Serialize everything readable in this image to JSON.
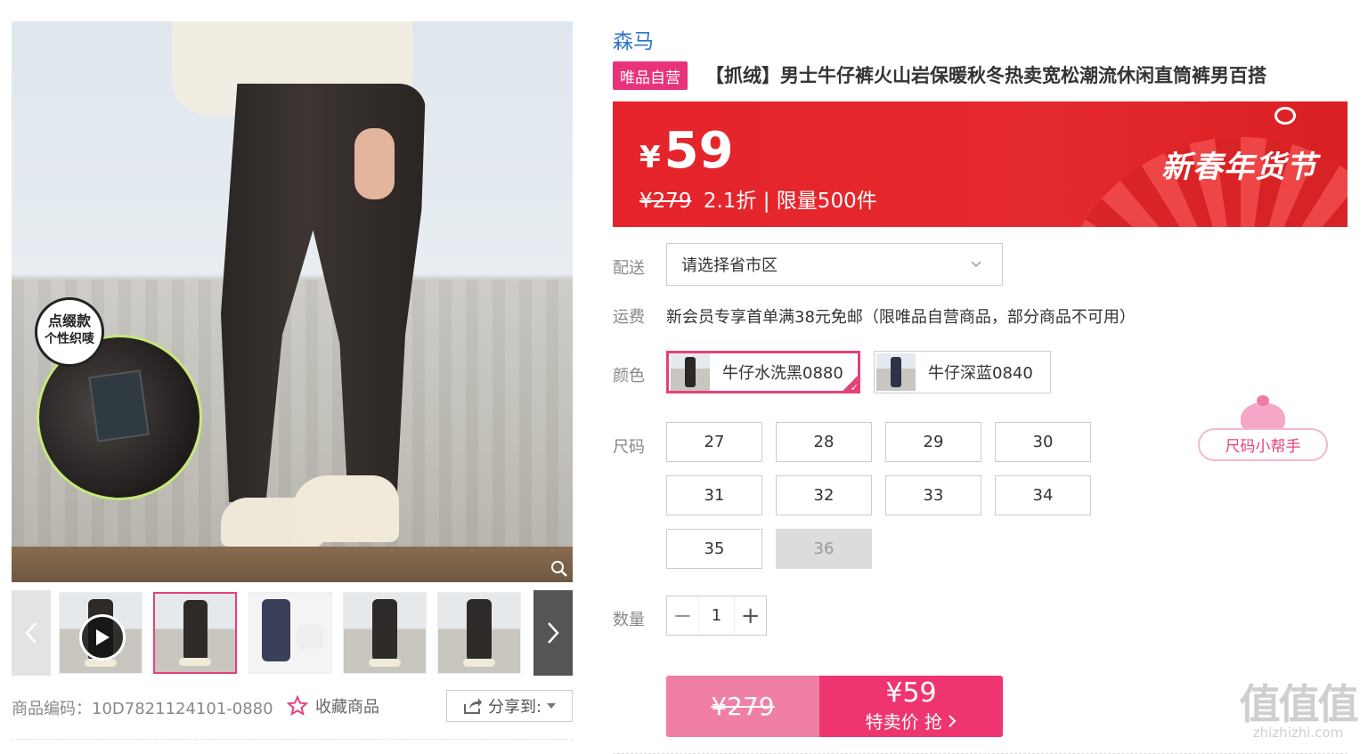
{
  "gallery": {
    "main_image_badge": [
      "点缀款",
      "个性织唛"
    ],
    "thumbnails": [
      {
        "kind": "video",
        "active": false
      },
      {
        "kind": "photo",
        "active": true
      },
      {
        "kind": "collage",
        "active": false
      },
      {
        "kind": "photo",
        "active": false
      },
      {
        "kind": "photo",
        "active": false
      },
      {
        "kind": "photo-partial",
        "active": false
      }
    ]
  },
  "meta": {
    "product_code": "商品编码：10D7821124101-0880",
    "favorite_label": "收藏商品",
    "share_label": "分享到:"
  },
  "product": {
    "brand": "森马",
    "tag": "唯品自营",
    "title": "【抓绒】男士牛仔裤火山岩保暖秋冬热卖宽松潮流休闲直筒裤男百搭"
  },
  "price": {
    "currency": "¥",
    "current": "59",
    "original": "¥279",
    "discount_info": "2.1折 | 限量500件",
    "festival": "新春年货节"
  },
  "delivery": {
    "label": "配送",
    "placeholder": "请选择省市区"
  },
  "shipping": {
    "label": "运费",
    "text": "新会员专享首单满38元免邮（限唯品自营商品，部分商品不可用）"
  },
  "colors": {
    "label": "颜色",
    "options": [
      {
        "name": "牛仔水洗黑0880",
        "selected": true
      },
      {
        "name": "牛仔深蓝0840",
        "selected": false
      }
    ]
  },
  "sizes": {
    "label": "尺码",
    "options": [
      "27",
      "28",
      "29",
      "30",
      "31",
      "32",
      "33",
      "34",
      "35",
      "36"
    ],
    "unavailable": [
      "36"
    ],
    "helper": "尺码小帮手"
  },
  "quantity": {
    "label": "数量",
    "value": "1",
    "minus": "−",
    "plus": "+"
  },
  "buy": {
    "original": "¥279",
    "price": "¥59",
    "label": "特卖价 抢"
  },
  "watermark": {
    "logo": "值值值",
    "url": "zhizhizhi.com"
  },
  "colors_theme": {
    "accent": "#e5417b",
    "banner_red": "#e5232b",
    "brand_blue": "#2f74c8"
  }
}
